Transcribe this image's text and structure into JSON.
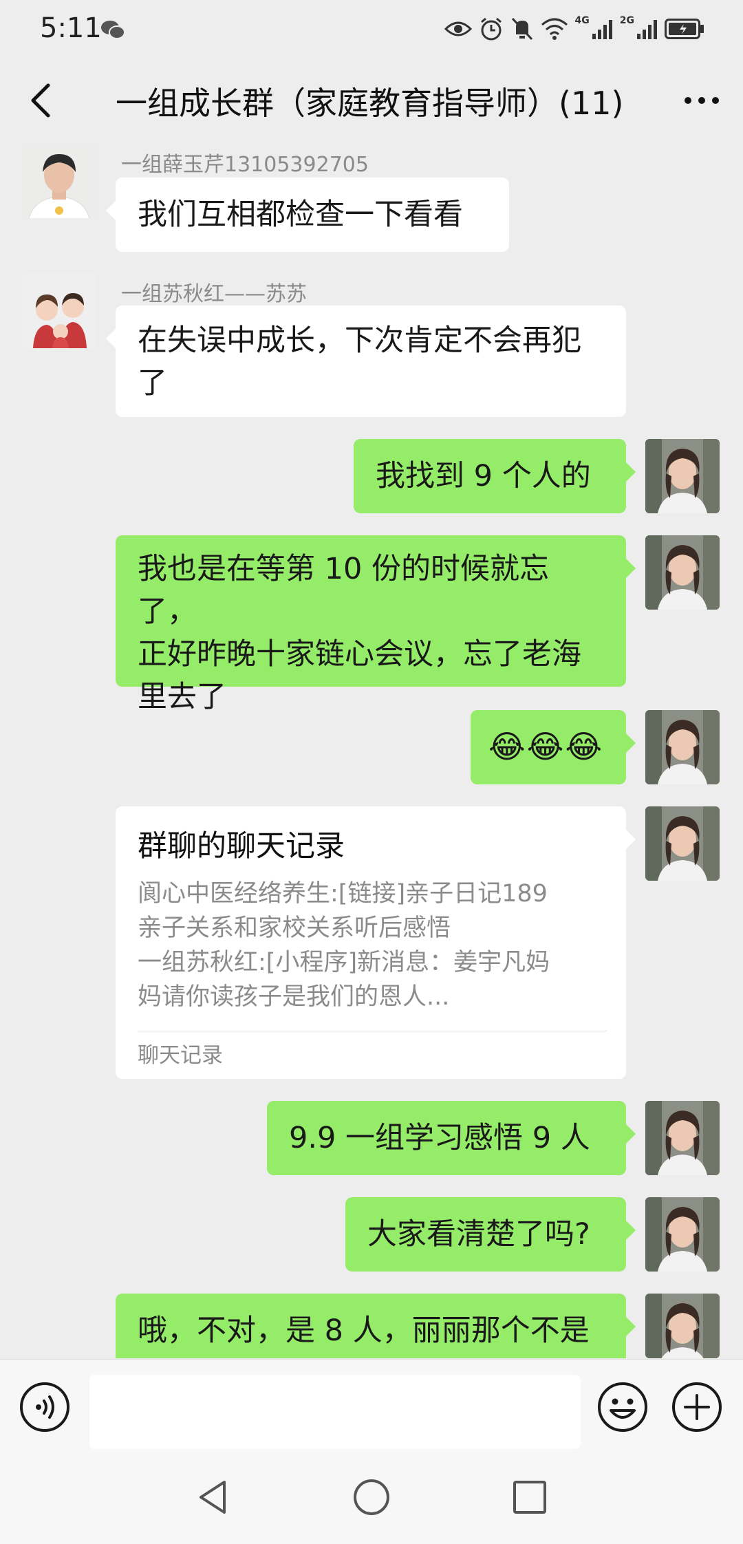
{
  "status_bar": {
    "time": "5:11",
    "signal1_label": "4G",
    "signal2_label": "2G",
    "icons": [
      "wechat-icon",
      "eye-icon",
      "alarm-icon",
      "mute-icon",
      "wifi-icon",
      "signal-icon",
      "signal-icon",
      "battery-icon"
    ]
  },
  "nav": {
    "title": "一组成长群（家庭教育指导师）(11)",
    "back_icon": "chevron-left-icon",
    "more_icon": "more-dots-icon"
  },
  "messages": [
    {
      "direction": "in",
      "sender": "一组薛玉芹13105392705",
      "text": "我们互相都检查一下看看"
    },
    {
      "direction": "in",
      "sender": "一组苏秋红——苏苏",
      "text_lines": [
        "在失误中成长，下次肯定不会再犯",
        "了"
      ]
    },
    {
      "direction": "out",
      "text": "我找到 9 个人的"
    },
    {
      "direction": "out",
      "text_lines": [
        "我也是在等第 10 份的时候就忘了，",
        "正好昨晚十家链心会议，忘了老海",
        "里去了"
      ]
    },
    {
      "direction": "out",
      "emoji": "😂😂😂"
    },
    {
      "direction": "out",
      "card": {
        "title": "群聊的聊天记录",
        "lines": [
          "阆心中医经络养生:[链接]亲子日记189",
          "亲子关系和家校关系听后感悟",
          "一组苏秋红:[小程序]新消息：姜宇凡妈",
          "妈请你读孩子是我们的恩人..."
        ],
        "footer": "聊天记录"
      }
    },
    {
      "direction": "out",
      "text": "9.9 一组学习感悟 9 人"
    },
    {
      "direction": "out",
      "text": "大家看清楚了吗?"
    },
    {
      "direction": "out",
      "text": "哦，不对，是 8 人，丽丽那个不是"
    }
  ],
  "input_bar": {
    "voice_icon": "voice-icon",
    "emoji_icon": "emoji-icon",
    "plus_icon": "plus-icon",
    "placeholder": ""
  },
  "system_nav": [
    "back-triangle-icon",
    "home-circle-icon",
    "recents-square-icon"
  ],
  "colors": {
    "outgoing": "#95ec69",
    "incoming": "#ffffff",
    "background": "#ededed"
  }
}
